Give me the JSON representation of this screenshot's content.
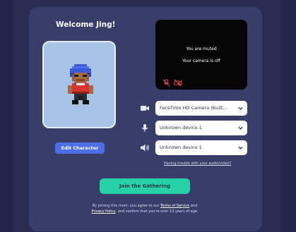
{
  "welcome_title": "Welcome Jing!",
  "avatar": {
    "edit_label": "Edit Character"
  },
  "camera_preview": {
    "muted_text": "You are muted",
    "camera_off_text": "Your camera is off"
  },
  "devices": {
    "camera": {
      "icon": "video-camera-icon",
      "value": "FaceTime HD Camera (Built..."
    },
    "microphone": {
      "icon": "microphone-icon",
      "value": "Unknown device 1"
    },
    "speaker": {
      "icon": "speaker-icon",
      "value": "Unknown device 1"
    }
  },
  "trouble_link": "Having trouble with your audio/video?",
  "join_button": "Join the Gathering",
  "terms": {
    "prefix": "By joining this room, you agree to our",
    "terms_link": "Terms of Service",
    "and": "and",
    "privacy_link": "Privacy Policy",
    "suffix": ", and confirm that you're over 13 years of age."
  },
  "colors": {
    "background": "#2a2d4f",
    "panel": "#393d6a",
    "accent_blue": "#4e6ee8",
    "join_green": "#27d3a6",
    "muted_red": "#e0454a"
  }
}
